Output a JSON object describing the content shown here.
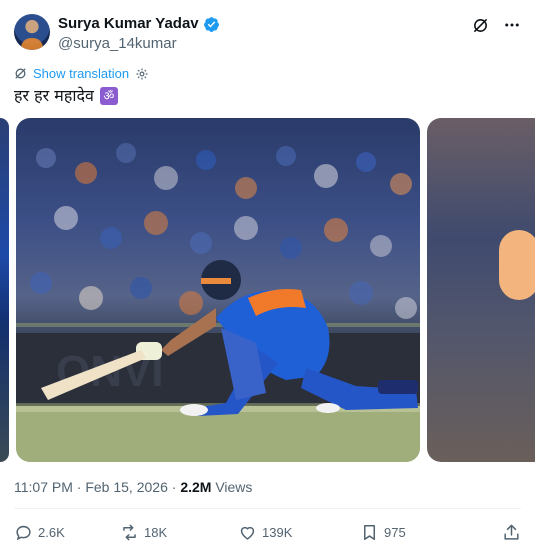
{
  "author": {
    "display_name": "Surya Kumar Yadav",
    "handle": "@surya_14kumar",
    "verified": true
  },
  "translate": {
    "label": "Show translation"
  },
  "tweet": {
    "text": "हर हर महादेव",
    "emoji": "om-symbol"
  },
  "media": {
    "count_visible": 3,
    "main_image": "cricket batsman playing sweep shot in blue-orange India jersey"
  },
  "meta": {
    "time": "11:07 PM",
    "separator": "·",
    "date": "Feb 15, 2026",
    "views_count": "2.2M",
    "views_label": "Views"
  },
  "engagement": {
    "replies": "2.6K",
    "reposts": "18K",
    "likes": "139K",
    "bookmarks": "975"
  },
  "colors": {
    "accent": "#1d9bf0",
    "text": "#0f1419",
    "muted": "#536471",
    "divider": "#eff3f4"
  }
}
